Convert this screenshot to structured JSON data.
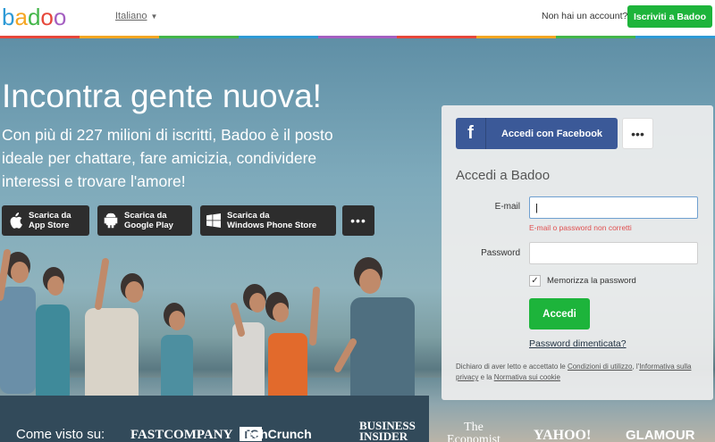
{
  "header": {
    "logo_text": "badoo",
    "language": "Italiano",
    "no_account": "Non hai un account?",
    "signup_button": "Iscriviti a Badoo",
    "stripe_colors": [
      "#e6473a",
      "#f5a623",
      "#43b649",
      "#2e9ad6",
      "#a45fc1",
      "#e6473a",
      "#f5a623",
      "#43b649",
      "#2e9ad6"
    ]
  },
  "hero": {
    "headline": "Incontra gente nuova!",
    "subline": "Con più di 227 milioni di iscritti, Badoo è il posto ideale per chattare, fare amicizia, condividere interessi e trovare l'amore!",
    "stores": [
      {
        "line1": "Scarica da",
        "line2": "App Store",
        "icon": "apple-icon"
      },
      {
        "line1": "Scarica da",
        "line2": "Google Play",
        "icon": "android-icon"
      },
      {
        "line1": "Scarica da",
        "line2": "Windows Phone Store",
        "icon": "windows-icon"
      }
    ],
    "more": "•••"
  },
  "press": {
    "label": "Come visto su:",
    "logos": [
      "FASTCOMPANY",
      "TechCrunch",
      "BUSINESS INSIDER",
      "The Economist",
      "YAHOO!",
      "GLAMOUR"
    ]
  },
  "login": {
    "facebook_button": "Accedi con Facebook",
    "facebook_glyph": "f",
    "more": "•••",
    "title": "Accedi a Badoo",
    "email_label": "E-mail",
    "email_value": "|",
    "error": "E-mail o password non corretti",
    "password_label": "Password",
    "password_value": "",
    "remember_label": "Memorizza la password",
    "remember_checked": true,
    "login_button": "Accedi",
    "forgot": "Password dimenticata?",
    "legal_prefix": "Dichiaro di aver letto e accettato le ",
    "legal_terms": "Condizioni di utilizzo",
    "legal_sep": ", l'",
    "legal_privacy": "Informativa sulla privacy",
    "legal_and": " e la ",
    "legal_cookie": "Normativa sui cookie"
  },
  "colors": {
    "accent_green": "#1db43b",
    "facebook_blue": "#3b5998",
    "error_red": "#e05050"
  }
}
